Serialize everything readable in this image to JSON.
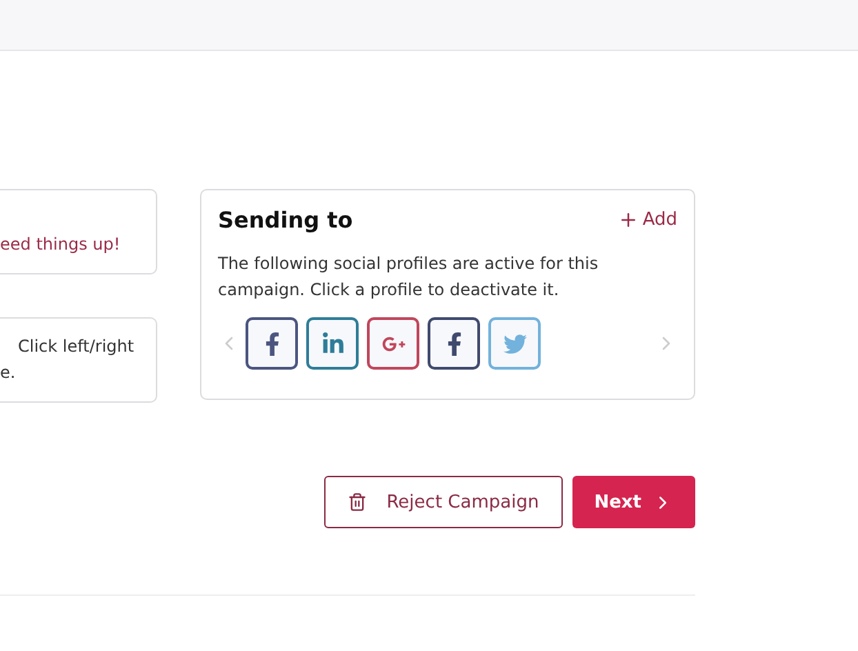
{
  "left_cards": [
    {
      "lines": [
        "eed things up!"
      ],
      "accent": true
    },
    {
      "lines": [
        "Click left/right",
        "e."
      ],
      "accent": false
    }
  ],
  "sending_card": {
    "title": "Sending to",
    "add_label": "Add",
    "description": "The following social profiles are active for this campaign. Click a profile to deactivate it.",
    "profiles": [
      {
        "kind": "facebook",
        "color": "#4b5580"
      },
      {
        "kind": "linkedin",
        "color": "#2e7d98"
      },
      {
        "kind": "googleplus",
        "color": "#c0475c"
      },
      {
        "kind": "facebook",
        "color": "#3f4a6e"
      },
      {
        "kind": "twitter",
        "color": "#72b2dc"
      }
    ]
  },
  "actions": {
    "reject": "Reject Campaign",
    "next": "Next"
  }
}
